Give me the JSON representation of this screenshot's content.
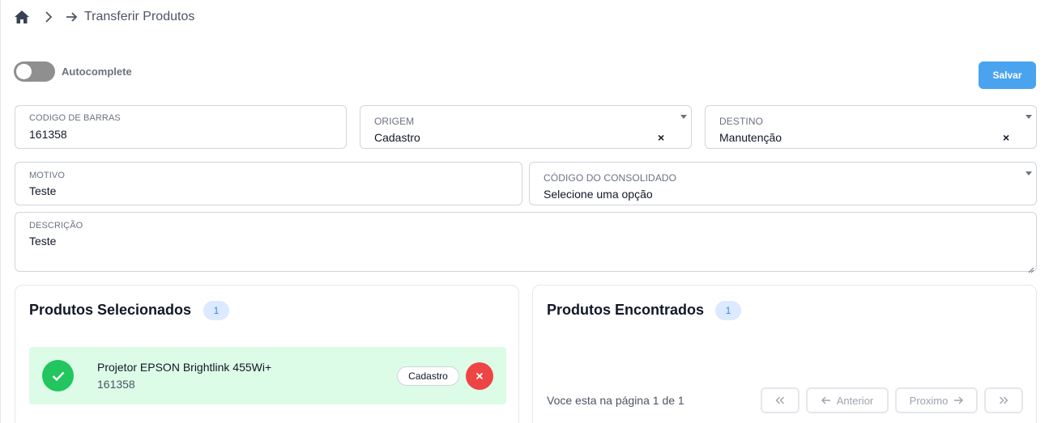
{
  "breadcrumb": {
    "home_icon": "home-icon",
    "separator_icon": "chevron-right-icon",
    "arrow_icon": "arrow-right-icon",
    "title": "Transferir Produtos"
  },
  "autocomplete": {
    "label": "Autocomplete",
    "enabled": false
  },
  "actions": {
    "save_label": "Salvar"
  },
  "form": {
    "codigo_barras": {
      "label": "CODIGO DE BARRAS",
      "value": "161358"
    },
    "origem": {
      "label": "ORIGEM",
      "value": "Cadastro",
      "clear": "×"
    },
    "destino": {
      "label": "DESTINO",
      "value": "Manutenção",
      "clear": "×"
    },
    "motivo": {
      "label": "MOTIVO",
      "value": "Teste"
    },
    "consolidado": {
      "label": "CÓDIGO DO CONSOLIDADO",
      "value": "Selecione uma opção"
    },
    "descricao": {
      "label": "DESCRIÇÃO",
      "value": "Teste"
    }
  },
  "selected": {
    "title": "Produtos Selecionados",
    "count": "1",
    "items": [
      {
        "name": "Projetor EPSON Brightlink 455Wi+",
        "code": "161358",
        "tag": "Cadastro"
      }
    ]
  },
  "found": {
    "title": "Produtos Encontrados",
    "count": "1",
    "pagination": {
      "info": "Voce esta na página 1 de 1",
      "first_icon": "double-chevron-left-icon",
      "prev_label": "Anterior",
      "next_label": "Proximo",
      "last_icon": "double-chevron-right-icon"
    }
  },
  "colors": {
    "primary": "#4aa3ef",
    "success": "#22c55e",
    "success_bg": "#dcfce7",
    "danger": "#ef4444",
    "badge_bg": "#dbeafe",
    "badge_text": "#3b82f6"
  }
}
